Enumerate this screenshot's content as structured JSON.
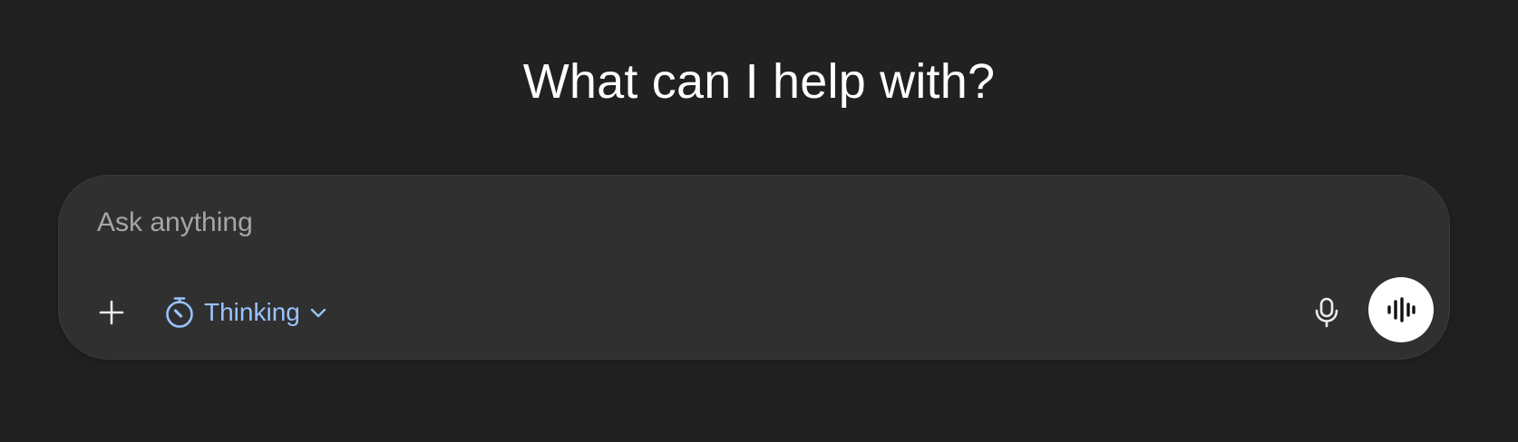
{
  "headline": "What can I help with?",
  "composer": {
    "placeholder": "Ask anything",
    "value": "",
    "mode_label": "Thinking"
  },
  "icons": {
    "add": "plus-icon",
    "mode": "timer-icon",
    "mode_dropdown": "chevron-down-icon",
    "dictate": "microphone-icon",
    "voice": "voice-waveform-icon"
  },
  "colors": {
    "background": "#212121",
    "composer": "#303030",
    "accent": "#99c3ff",
    "placeholder": "#a6a6a6"
  }
}
